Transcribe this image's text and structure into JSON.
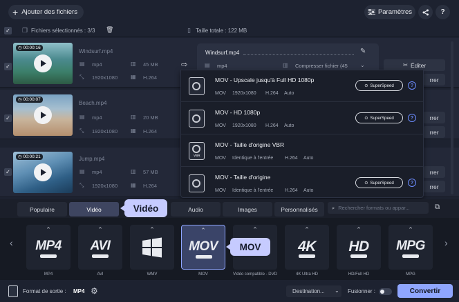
{
  "toolbar": {
    "add_files_label": "Ajouter des fichiers",
    "settings_label": "Paramètres",
    "share_icon": "share-icon",
    "help_label": "?"
  },
  "selection": {
    "selected_text": "Fichiers sélectionnés : 3/3",
    "total_size": "Taille totale : 122 MB"
  },
  "files": [
    {
      "name": "Windsurf.mp4",
      "duration": "00:00:16",
      "format": "mp4",
      "size": "45 MB",
      "resolution": "1920x1080",
      "codec": "H.264"
    },
    {
      "name": "Beach.mp4",
      "duration": "00:00:07",
      "format": "mp4",
      "size": "20 MB",
      "resolution": "1920x1080",
      "codec": "H.264"
    },
    {
      "name": "Jump.mp4",
      "duration": "00:00:21",
      "format": "mp4",
      "size": "57 MB",
      "resolution": "1920x1080",
      "codec": "H.264"
    }
  ],
  "output_card": {
    "filename": "Windsurf.mp4",
    "format": "mp4",
    "compress_label": "Compresser fichier (45"
  },
  "edit_label": "Éditer",
  "partial_button_label": "rrer",
  "presets": [
    {
      "title": "MOV - Upscale jusqu'à Full HD 1080p",
      "container": "MOV",
      "resolution": "1920x1080",
      "codec": "H.264",
      "audio": "Auto",
      "superspeed": true
    },
    {
      "title": "MOV - HD 1080p",
      "container": "MOV",
      "resolution": "1920x1080",
      "codec": "H.264",
      "audio": "Auto",
      "superspeed": true
    },
    {
      "title": "MOV - Taille d'origine VBR",
      "container": "MOV",
      "resolution": "Identique à l'entrée",
      "codec": "H.264",
      "audio": "Auto",
      "superspeed": false,
      "badge": "VBR"
    },
    {
      "title": "MOV - Taille d'origine",
      "container": "MOV",
      "resolution": "Identique à l'entrée",
      "codec": "H.264",
      "audio": "Auto",
      "superspeed": true
    }
  ],
  "superspeed_label": "SuperSpeed",
  "tabs": [
    "Populaire",
    "Vidéo",
    "",
    "Audio",
    "Images",
    "Personnalisés"
  ],
  "search_placeholder": "Rechercher formats ou appar...",
  "formats": [
    {
      "logo": "MP4",
      "label": "MP4"
    },
    {
      "logo": "AVI",
      "label": "AVI"
    },
    {
      "logo": "",
      "label": "WMV"
    },
    {
      "logo": "MOV",
      "label": "MOV"
    },
    {
      "logo": "",
      "label": "Vidéo compatible - DVD"
    },
    {
      "logo": "4K",
      "label": "4K Ultra HD"
    },
    {
      "logo": "HD",
      "label": "HD/Full HD"
    },
    {
      "logo": "MPG",
      "label": "MPG"
    }
  ],
  "footer": {
    "output_format_label": "Format de sortie :",
    "output_format_value": "MP4",
    "destination_label": "Destination...",
    "merge_label": "Fusionner :",
    "convert_label": "Convertir"
  },
  "callouts": {
    "video": "Vidéo",
    "mov": "MOV"
  },
  "colors": {
    "accent": "#8fa6ff",
    "callout": "#c6cbff",
    "background": "#1d2230"
  }
}
